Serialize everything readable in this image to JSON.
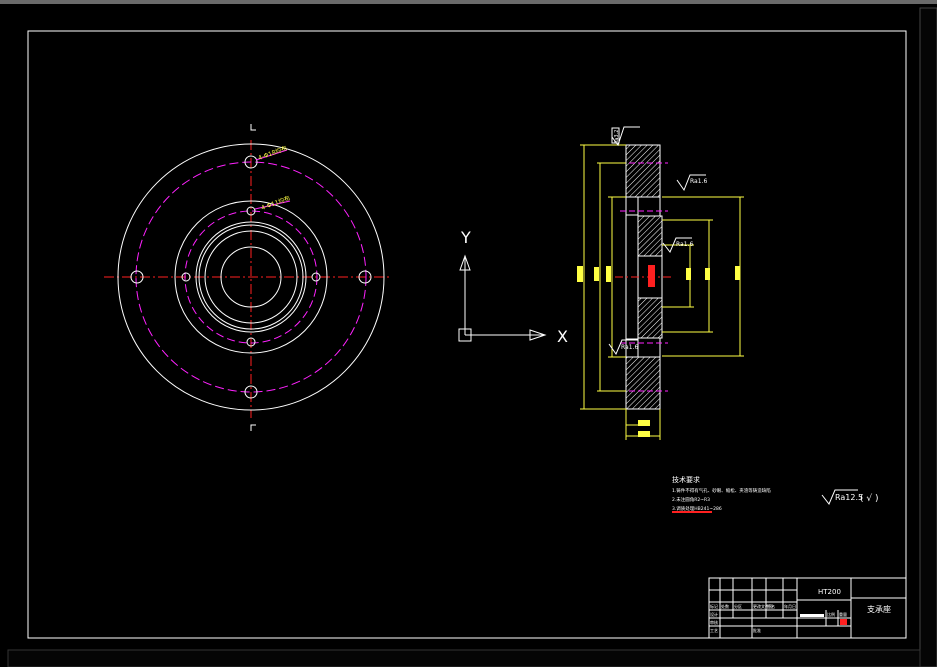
{
  "drawing": {
    "ucs_y_label": "Y",
    "ucs_x_label": "X",
    "tech_requirements": {
      "title": "技术要求",
      "line1": "1.铸件不得有气孔、砂眼、缩松、夹渣等铸造缺陷",
      "line2": "2.未注圆角R2~R3",
      "line3": "3.调质处理HB241~286"
    },
    "surface_finish": "Ra12.5",
    "surface_finish_suffix": "( √ )",
    "roughness_marks": [
      "Ra3.2",
      "Ra1.6",
      "Ra1.6",
      "Ra1.6"
    ],
    "hole_callouts": [
      "4-Φ18均布",
      "4-Φ11均布"
    ],
    "title_block": {
      "material": "HT200",
      "part_name": "支承座",
      "row_labels": [
        "标记",
        "处数",
        "分区",
        "更改文件号",
        "签名",
        "年月日"
      ],
      "left_labels": [
        "设计",
        "审核",
        "工艺",
        "批准"
      ],
      "scale_labels": [
        "比例",
        "重量"
      ]
    }
  }
}
